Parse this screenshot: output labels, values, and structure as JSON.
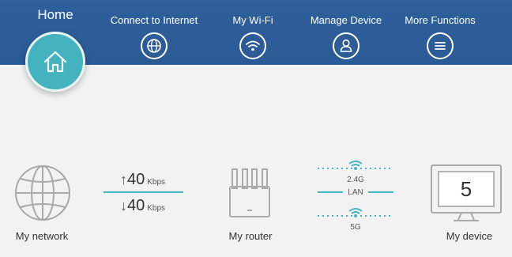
{
  "nav": {
    "home_label": "Home",
    "items": [
      {
        "label": "Connect to Internet",
        "icon": "globe-icon"
      },
      {
        "label": "My Wi-Fi",
        "icon": "wifi-icon"
      },
      {
        "label": "Manage Device",
        "icon": "user-icon"
      },
      {
        "label": "More Functions",
        "icon": "menu-icon"
      }
    ]
  },
  "network": {
    "label": "My network",
    "upload_value": "40",
    "upload_unit": "Kbps",
    "download_value": "40",
    "download_unit": "Kbps"
  },
  "router": {
    "label": "My router",
    "band_24": "2.4G",
    "lan": "LAN",
    "band_5": "5G"
  },
  "device": {
    "label": "My device",
    "count": "5"
  },
  "colors": {
    "topbar": "#2f5f9c",
    "accent": "#44b3bf"
  }
}
